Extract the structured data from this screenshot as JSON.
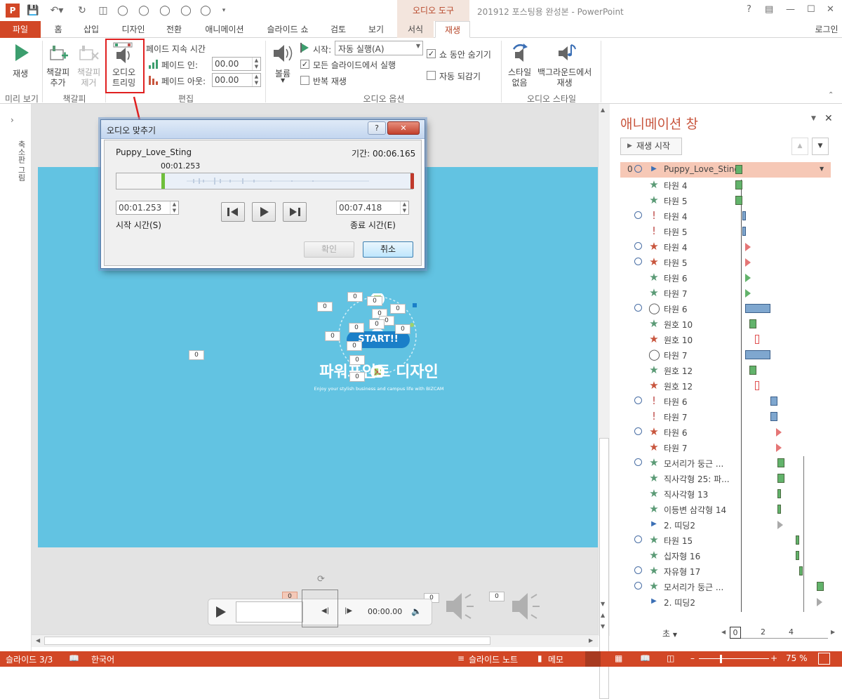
{
  "titlebar": {
    "context_group": "오디오 도구",
    "document_title": "201912 포스팅용 완성본 - PowerPoint",
    "help": "?",
    "login": "로그인"
  },
  "tabs": [
    "파일",
    "홈",
    "삽입",
    "디자인",
    "전환",
    "애니메이션",
    "슬라이드 쇼",
    "검토",
    "보기",
    "서식",
    "재생"
  ],
  "ribbon": {
    "preview": {
      "play": "재생",
      "group": "미리 보기"
    },
    "bookmarks": {
      "add_line1": "책갈피",
      "add_line2": "추가",
      "remove_line1": "책갈피",
      "remove_line2": "제거",
      "group": "책갈피"
    },
    "editing": {
      "trim_line1": "오디오",
      "trim_line2": "트리밍",
      "fade_duration": "페이드 지속 시간",
      "fade_in_label": "페이드 인:",
      "fade_in_value": "00.00",
      "fade_out_label": "페이드 아웃:",
      "fade_out_value": "00.00",
      "group": "편집"
    },
    "audio_options": {
      "volume": "볼륨",
      "start_label": "시작:",
      "start_value": "자동 실행(A)",
      "play_across": "모든 슬라이드에서 실행",
      "loop": "반복 재생",
      "hide_during_show": "쇼 동안 숨기기",
      "rewind": "자동 되감기",
      "group": "오디오 옵션"
    },
    "audio_styles": {
      "no_style_line1": "스타일",
      "no_style_line2": "없음",
      "bg_line1": "백그라운드에서",
      "bg_line2": "재생",
      "group": "오디오 스타일"
    }
  },
  "left_panel": {
    "label": "축소판 그림"
  },
  "dialog": {
    "title": "오디오 맞추기",
    "help": "?",
    "close": "✕",
    "file_name": "Puppy_Love_Sting",
    "duration": "기간: 00:06.165",
    "marker_time": "00:01.253",
    "start_time_value": "00:01.253",
    "start_time_label": "시작 시간(S)",
    "end_time_value": "00:07.418",
    "end_time_label": "종료 시간(E)",
    "ok": "확인",
    "cancel": "취소"
  },
  "slide": {
    "title": "파워포인트 디자인",
    "subtitle": "Enjoy your stylish business and campus life with BIZCAM",
    "start": "START!!",
    "zero": "0"
  },
  "player": {
    "time": "00:00.00"
  },
  "animation_pane": {
    "title": "애니메이션 창",
    "play_button": "재생 시작",
    "items": [
      {
        "num": "0",
        "clock": true,
        "icon": "triangle",
        "color": "#3b6fb5",
        "label": "Puppy_Love_Sting",
        "selected": true
      },
      {
        "num": "",
        "clock": false,
        "icon": "star",
        "color": "#5a9a75",
        "label": "타원 4"
      },
      {
        "num": "",
        "clock": false,
        "icon": "star",
        "color": "#5a9a75",
        "label": "타원 5"
      },
      {
        "num": "",
        "clock": true,
        "icon": "line",
        "color": "#c0504d",
        "label": "타원 4"
      },
      {
        "num": "",
        "clock": false,
        "icon": "line",
        "color": "#c0504d",
        "label": "타원 5"
      },
      {
        "num": "",
        "clock": true,
        "icon": "star",
        "color": "#c8553d",
        "label": "타원 4"
      },
      {
        "num": "",
        "clock": true,
        "icon": "star",
        "color": "#c8553d",
        "label": "타원 5"
      },
      {
        "num": "",
        "clock": false,
        "icon": "star",
        "color": "#5a9a75",
        "label": "타원 6"
      },
      {
        "num": "",
        "clock": false,
        "icon": "star",
        "color": "#5a9a75",
        "label": "타원 7"
      },
      {
        "num": "",
        "clock": true,
        "icon": "ring",
        "color": "#555555",
        "label": "타원 6"
      },
      {
        "num": "",
        "clock": false,
        "icon": "star",
        "color": "#5a9a75",
        "label": "원호 10"
      },
      {
        "num": "",
        "clock": false,
        "icon": "star",
        "color": "#c8553d",
        "label": "원호 10"
      },
      {
        "num": "",
        "clock": false,
        "icon": "ring",
        "color": "#555555",
        "label": "타원 7"
      },
      {
        "num": "",
        "clock": false,
        "icon": "star",
        "color": "#5a9a75",
        "label": "원호 12"
      },
      {
        "num": "",
        "clock": false,
        "icon": "star",
        "color": "#c8553d",
        "label": "원호 12"
      },
      {
        "num": "",
        "clock": true,
        "icon": "line",
        "color": "#c0504d",
        "label": "타원 6"
      },
      {
        "num": "",
        "clock": false,
        "icon": "line",
        "color": "#c0504d",
        "label": "타원 7"
      },
      {
        "num": "",
        "clock": true,
        "icon": "star",
        "color": "#c8553d",
        "label": "타원 6"
      },
      {
        "num": "",
        "clock": false,
        "icon": "star",
        "color": "#c8553d",
        "label": "타원 7"
      },
      {
        "num": "",
        "clock": true,
        "icon": "star",
        "color": "#5a9a75",
        "label": "모서리가 둥근 ..."
      },
      {
        "num": "",
        "clock": false,
        "icon": "star",
        "color": "#5a9a75",
        "label": "직사각형 25: 파..."
      },
      {
        "num": "",
        "clock": false,
        "icon": "star",
        "color": "#5a9a75",
        "label": "직사각형 13"
      },
      {
        "num": "",
        "clock": false,
        "icon": "star",
        "color": "#5a9a75",
        "label": "이등변 삼각형 14"
      },
      {
        "num": "",
        "clock": false,
        "icon": "triangle",
        "color": "#3b6fb5",
        "label": "2. 띠딩2"
      },
      {
        "num": "",
        "clock": true,
        "icon": "star",
        "color": "#5a9a75",
        "label": "타원 15"
      },
      {
        "num": "",
        "clock": false,
        "icon": "star",
        "color": "#5a9a75",
        "label": "십자형 16"
      },
      {
        "num": "",
        "clock": true,
        "icon": "star",
        "color": "#5a9a75",
        "label": "자유형 17"
      },
      {
        "num": "",
        "clock": true,
        "icon": "star",
        "color": "#5a9a75",
        "label": "모서리가 둥근 ..."
      },
      {
        "num": "",
        "clock": false,
        "icon": "triangle",
        "color": "#3b6fb5",
        "label": "2. 띠딩2"
      }
    ],
    "seconds_label": "초",
    "timeline": [
      "0",
      "2",
      "4"
    ]
  },
  "statusbar": {
    "slide": "슬라이드 3/3",
    "language": "한국어",
    "notes": "슬라이드 노트",
    "comments": "메모",
    "zoom": "75 %"
  },
  "colors": {
    "accent": "#d24726",
    "slide_bg": "#62c3e2",
    "highlight_border": "#e02020"
  }
}
